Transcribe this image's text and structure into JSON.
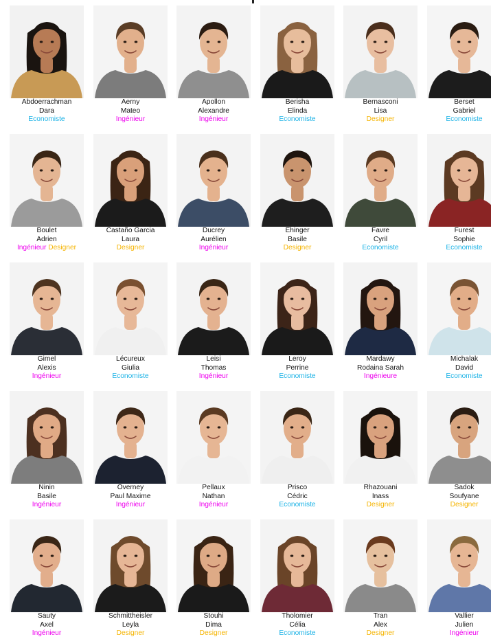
{
  "colors": {
    "Economiste": "#1ab2e6",
    "Ingénieur": "#ee00ee",
    "Ingénieure": "#ee00ee",
    "Designer": "#f5b400"
  },
  "people": [
    {
      "last": "Abdoerrachman",
      "first": "Dara",
      "roles": [
        "Economiste"
      ],
      "bg": "#f2f2f2",
      "shirt": "#c89a55",
      "skin": "#b77b55",
      "hair": "#1a1410",
      "long": true
    },
    {
      "last": "Aerny",
      "first": "Mateo",
      "roles": [
        "Ingénieur"
      ],
      "bg": "#f4f4f4",
      "shirt": "#7c7c7c",
      "skin": "#e2b08c",
      "hair": "#5a3d26",
      "long": false
    },
    {
      "last": "Apollon",
      "first": "Alexandre",
      "roles": [
        "Ingénieur"
      ],
      "bg": "#f3f3f3",
      "shirt": "#8f8f8f",
      "skin": "#e4b592",
      "hair": "#2b1c12",
      "long": false
    },
    {
      "last": "Berisha",
      "first": "Elinda",
      "roles": [
        "Economiste"
      ],
      "bg": "#f4f4f4",
      "shirt": "#1a1a1a",
      "skin": "#e7bd9c",
      "hair": "#8a6240",
      "long": true
    },
    {
      "last": "Bernasconi",
      "first": "Lisa",
      "roles": [
        "Designer"
      ],
      "bg": "#f3f3f3",
      "shirt": "#b7c0c2",
      "skin": "#e8bea0",
      "hair": "#4a2e1c",
      "long": false
    },
    {
      "last": "Berset",
      "first": "Gabriel",
      "roles": [
        "Economiste"
      ],
      "bg": "#f5f5f5",
      "shirt": "#1c1c1c",
      "skin": "#e6b898",
      "hair": "#2a1c12",
      "long": false
    },
    {
      "last": "Boulet",
      "first": "Adrien",
      "roles": [
        "Ingénieur",
        "Designer"
      ],
      "bg": "#f4f4f4",
      "shirt": "#9b9b9b",
      "skin": "#e4b593",
      "hair": "#3a2616",
      "long": false
    },
    {
      "last": "Castaño Garcia",
      "first": "Laura",
      "roles": [
        "Designer"
      ],
      "bg": "#f4f4f4",
      "shirt": "#1b1b1b",
      "skin": "#d9a07a",
      "hair": "#3b2414",
      "long": true
    },
    {
      "last": "Ducrey",
      "first": "Aurélien",
      "roles": [
        "Ingénieur"
      ],
      "bg": "#f3f3f3",
      "shirt": "#3c4d66",
      "skin": "#e4b28e",
      "hair": "#4a301c",
      "long": false
    },
    {
      "last": "Ehinger",
      "first": "Basile",
      "roles": [
        "Designer"
      ],
      "bg": "#f3f3f3",
      "shirt": "#1e1e1e",
      "skin": "#c9946e",
      "hair": "#1e140e",
      "long": false
    },
    {
      "last": "Favre",
      "first": "Cyril",
      "roles": [
        "Economiste"
      ],
      "bg": "#f4f4f4",
      "shirt": "#3f4a3a",
      "skin": "#e0ac88",
      "hair": "#5a3a22",
      "long": false
    },
    {
      "last": "Furest",
      "first": "Sophie",
      "roles": [
        "Economiste"
      ],
      "bg": "#f3f3f3",
      "shirt": "#8a2424",
      "skin": "#e6b696",
      "hair": "#5c3a22",
      "long": true
    },
    {
      "last": "Gimel",
      "first": "Alexis",
      "roles": [
        "Ingénieur"
      ],
      "bg": "#f3f3f3",
      "shirt": "#2a2e36",
      "skin": "#e6b694",
      "hair": "#4e3420",
      "long": false
    },
    {
      "last": "Lécureux",
      "first": "Giulia",
      "roles": [
        "Economiste"
      ],
      "bg": "#f4f4f4",
      "shirt": "#f0f0f0",
      "skin": "#e7b898",
      "hair": "#7a5030",
      "long": false
    },
    {
      "last": "Leisi",
      "first": "Thomas",
      "roles": [
        "Ingénieur"
      ],
      "bg": "#f3f3f3",
      "shirt": "#1b1b1b",
      "skin": "#e4b290",
      "hair": "#3a2616",
      "long": false
    },
    {
      "last": "Leroy",
      "first": "Perrine",
      "roles": [
        "Economiste"
      ],
      "bg": "#f4f4f4",
      "shirt": "#1a1a1a",
      "skin": "#e8bca0",
      "hair": "#3c2418",
      "long": true
    },
    {
      "last": "Mardawy",
      "first": "Rodaina Sarah",
      "roles": [
        "Ingénieure"
      ],
      "bg": "#f3f3f3",
      "shirt": "#1e2a44",
      "skin": "#d9a27e",
      "hair": "#231610",
      "long": true
    },
    {
      "last": "Michalak",
      "first": "David",
      "roles": [
        "Economiste"
      ],
      "bg": "#f5f5f5",
      "shirt": "#cfe3ea",
      "skin": "#e2ad88",
      "hair": "#7a5434",
      "long": false
    },
    {
      "last": "Ninin",
      "first": "Basile",
      "roles": [
        "Ingénieur"
      ],
      "bg": "#f3f3f3",
      "shirt": "#7d7d7d",
      "skin": "#e0aa86",
      "hair": "#4c3020",
      "long": true
    },
    {
      "last": "Overney",
      "first": "Paul Maxime",
      "roles": [
        "Ingénieur"
      ],
      "bg": "#f4f4f4",
      "shirt": "#1c2230",
      "skin": "#e4b290",
      "hair": "#3e2818",
      "long": false
    },
    {
      "last": "Pellaux",
      "first": "Nathan",
      "roles": [
        "Ingénieur"
      ],
      "bg": "#f4f4f4",
      "shirt": "#f2f2f2",
      "skin": "#e6b694",
      "hair": "#5a3a22",
      "long": false
    },
    {
      "last": "Prisco",
      "first": "Cédric",
      "roles": [
        "Economiste"
      ],
      "bg": "#f3f3f3",
      "shirt": "#efefef",
      "skin": "#e2ae8a",
      "hair": "#3a2616",
      "long": false
    },
    {
      "last": "Rhazouani",
      "first": "Inass",
      "roles": [
        "Designer"
      ],
      "bg": "#f4f4f4",
      "shirt": "#f1f1f1",
      "skin": "#d9a27e",
      "hair": "#1a120c",
      "long": true
    },
    {
      "last": "Sadok",
      "first": "Soufyane",
      "roles": [
        "Designer"
      ],
      "bg": "#f3f3f3",
      "shirt": "#8e8e8e",
      "skin": "#d8a47e",
      "hair": "#2a1c12",
      "long": false
    },
    {
      "last": "Sauty",
      "first": "Axel",
      "roles": [
        "Ingénieur"
      ],
      "bg": "#f4f4f4",
      "shirt": "#222831",
      "skin": "#e2ae8c",
      "hair": "#3a2616",
      "long": false
    },
    {
      "last": "Schmittheisler",
      "first": "Leyla",
      "roles": [
        "Designer"
      ],
      "bg": "#f3f3f3",
      "shirt": "#1b1b1b",
      "skin": "#e6b696",
      "hair": "#6e4a2c",
      "long": true
    },
    {
      "last": "Stouhi",
      "first": "Dima",
      "roles": [
        "Designer"
      ],
      "bg": "#f4f4f4",
      "shirt": "#1a1a1a",
      "skin": "#deaa86",
      "hair": "#3a2414",
      "long": true
    },
    {
      "last": "Tholomier",
      "first": "Célia",
      "roles": [
        "Economiste"
      ],
      "bg": "#f3f3f3",
      "shirt": "#6e2a36",
      "skin": "#e6b898",
      "hair": "#6a4428",
      "long": true
    },
    {
      "last": "Tran",
      "first": "Alex",
      "roles": [
        "Designer"
      ],
      "bg": "#f4f4f4",
      "shirt": "#8a8a8a",
      "skin": "#e6c09e",
      "hair": "#6a3a1e",
      "long": false
    },
    {
      "last": "Vallier",
      "first": "Julien",
      "roles": [
        "Ingénieur"
      ],
      "bg": "#f4f4f4",
      "shirt": "#5f77a8",
      "skin": "#e6b694",
      "hair": "#8a6a3e",
      "long": false
    }
  ]
}
